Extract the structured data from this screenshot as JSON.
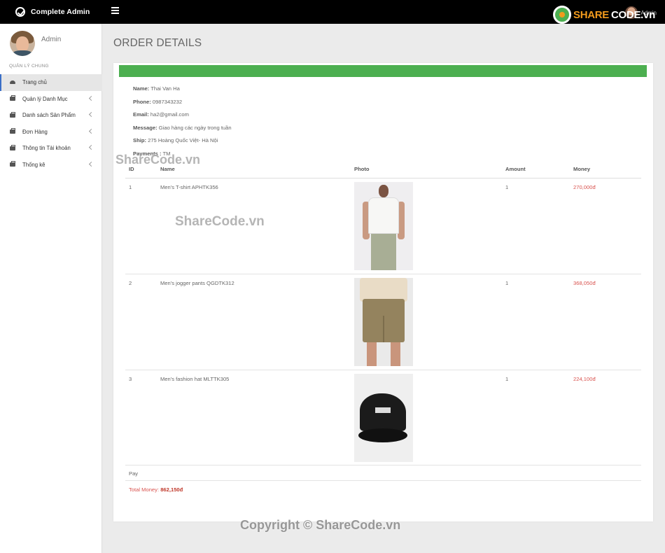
{
  "topbar": {
    "brand": "Complete Admin",
    "user": "Admin"
  },
  "watermark_logo": {
    "part1": "SHARE",
    "part2": "CODE.vn"
  },
  "sidebar": {
    "profile_name": "Admin",
    "section": "QUẢN LÝ CHUNG",
    "items": [
      {
        "label": "Trang chủ",
        "active": true,
        "icon": "dashboard-icon"
      },
      {
        "label": "Quản lý Danh Mục",
        "icon": "briefcase-icon"
      },
      {
        "label": "Danh sách Sản Phẩm",
        "icon": "briefcase-icon"
      },
      {
        "label": "Đơn Hàng",
        "icon": "briefcase-icon"
      },
      {
        "label": "Thông tin Tài khoản",
        "icon": "briefcase-icon"
      },
      {
        "label": "Thống kê",
        "icon": "briefcase-icon"
      }
    ]
  },
  "page": {
    "title": "ORDER DETAILS"
  },
  "order": {
    "name_label": "Name:",
    "name": "Thai Van Ha",
    "phone_label": "Phone:",
    "phone": "0987343232",
    "email_label": "Email:",
    "email": "ha2@gmail.com",
    "message_label": "Message:",
    "message": "Giao hàng các ngày trong tuần",
    "ship_label": "Ship:",
    "ship": "275 Hoàng Quốc Việt- Hà Nội",
    "payments_label": "Payments :",
    "payments": "TM"
  },
  "table": {
    "headers": {
      "id": "ID",
      "name": "Name",
      "photo": "Photo",
      "amount": "Amount",
      "money": "Money"
    },
    "rows": [
      {
        "id": "1",
        "name": "Men's T-shirt APHTK356",
        "amount": "1",
        "money": "270,000đ"
      },
      {
        "id": "2",
        "name": "Men's jogger pants QGDTK312",
        "amount": "1",
        "money": "368,050đ"
      },
      {
        "id": "3",
        "name": "Men's fashion hat MLTTK305",
        "amount": "1",
        "money": "224,100đ"
      }
    ]
  },
  "pay_label": "Pay",
  "total": {
    "label": "Total Money:",
    "value": "862,150đ"
  },
  "watermarks": {
    "center1": "ShareCode.vn",
    "center2": "ShareCode.vn",
    "footer": "Copyright © ShareCode.vn"
  },
  "colors": {
    "accent_green": "#4caf50",
    "money_red": "#d9534f",
    "active_border": "#3a6ec7"
  }
}
